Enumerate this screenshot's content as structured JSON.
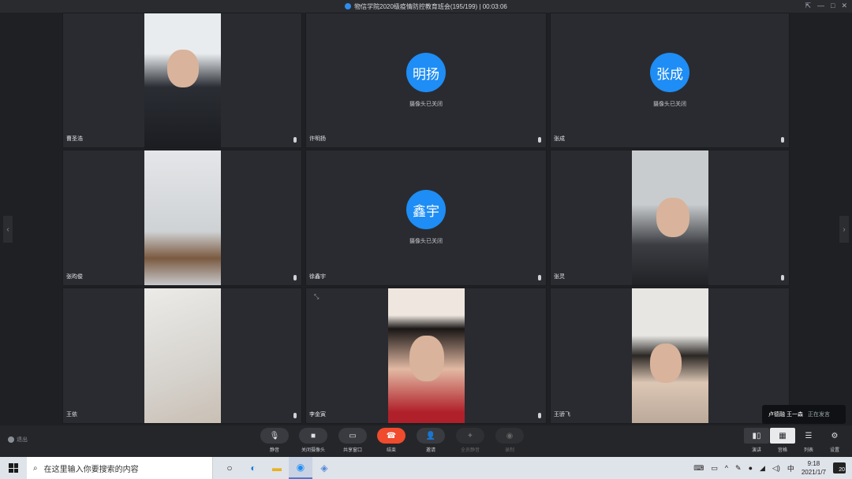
{
  "titlebar": {
    "title": "物信学院2020级疫情防控教育班会(195/199) | 00:03:06"
  },
  "tiles": [
    {
      "name": "曹圣浩",
      "camera_off": false
    },
    {
      "name": "许明扬",
      "camera_off": true,
      "avatar": "明扬",
      "status": "摄像头已关闭"
    },
    {
      "name": "张成",
      "camera_off": true,
      "avatar": "张成",
      "status": "摄像头已关闭"
    },
    {
      "name": "张昀俊",
      "camera_off": false
    },
    {
      "name": "徐鑫宇",
      "camera_off": true,
      "avatar": "鑫宇",
      "status": "摄像头已关闭"
    },
    {
      "name": "张灵",
      "camera_off": false
    },
    {
      "name": "王依",
      "camera_off": false
    },
    {
      "name": "李金寅",
      "camera_off": false
    },
    {
      "name": "王骄飞",
      "camera_off": false
    }
  ],
  "speaking": {
    "names": "卢德融 王一森",
    "hint": "正在发言"
  },
  "controls": {
    "exit": "退出",
    "mute": "静音",
    "camera": "关闭摄像头",
    "share": "共享窗口",
    "hangup": "结束",
    "invite": "邀请",
    "all_mute": "全员静音",
    "record": "录制",
    "layout_speaker": "演讲",
    "layout_grid": "宫格",
    "layout_list": "列表",
    "settings": "设置"
  },
  "taskbar": {
    "search_placeholder": "在这里输入你要搜索的内容",
    "ime": "中",
    "time": "9:18",
    "date": "2021/1/7",
    "notifications": "20"
  },
  "colors": {
    "accent": "#1e8df5",
    "hangup": "#f04b2d"
  }
}
